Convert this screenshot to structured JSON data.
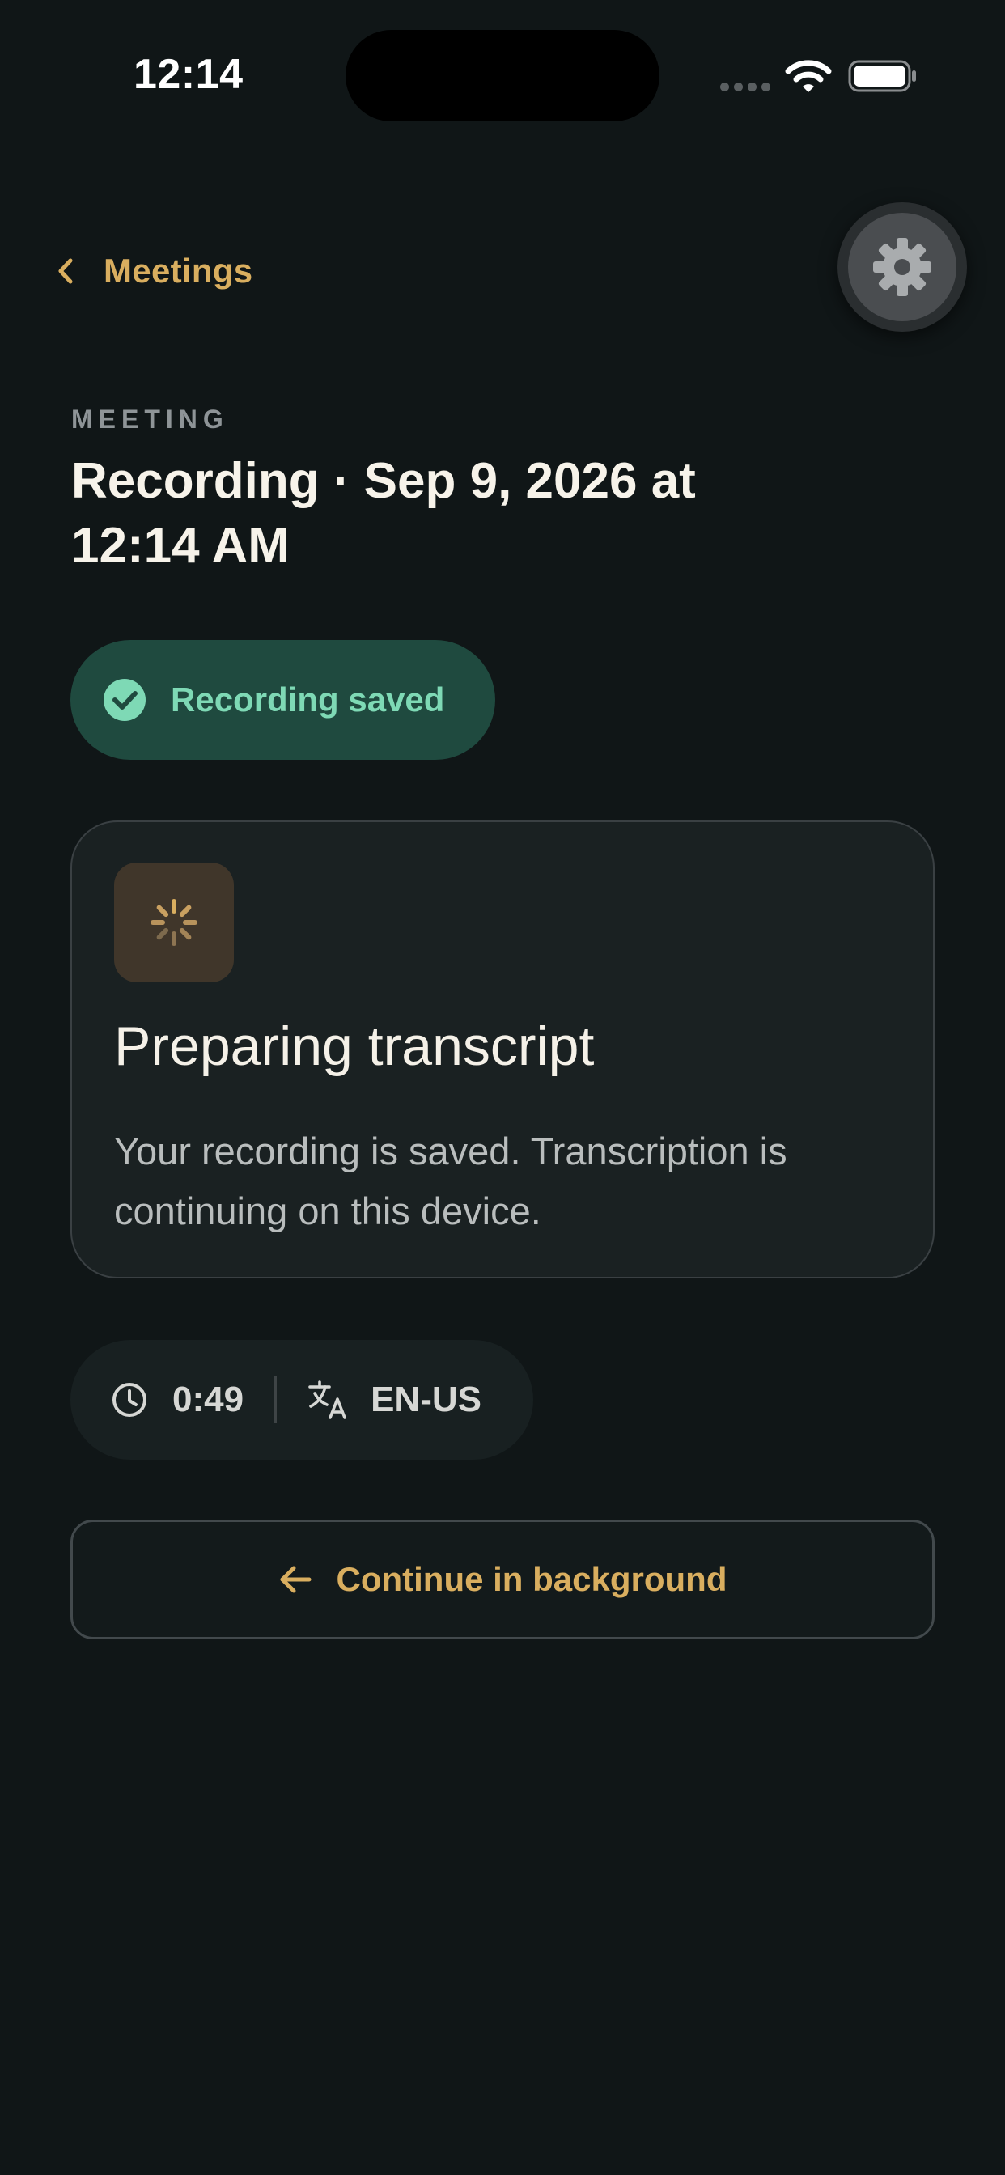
{
  "status_bar": {
    "time": "12:14"
  },
  "nav": {
    "back_label": "Meetings"
  },
  "header": {
    "eyebrow": "MEETING",
    "title": "Recording · Sep 9, 2026 at 12:14 AM"
  },
  "saved_badge": {
    "label": "Recording saved"
  },
  "transcript_card": {
    "title": "Preparing transcript",
    "body": "Your recording is saved. Transcription is continuing on this device."
  },
  "meta": {
    "duration": "0:49",
    "language": "EN-US"
  },
  "actions": {
    "continue_label": "Continue in background"
  },
  "icons": {
    "back": "chevron-left-icon",
    "settings": "gear-icon",
    "saved": "check-circle-icon",
    "spinner": "loading-spinner-icon",
    "duration": "clock-icon",
    "language": "translate-icon",
    "continue": "arrow-left-icon"
  },
  "colors": {
    "background": "#101617",
    "accent": "#D9AE5F",
    "success_bg": "#1F4A3F",
    "success_fg": "#7ED9B5",
    "card_bg": "#1A2122",
    "card_border": "#3A4043"
  }
}
